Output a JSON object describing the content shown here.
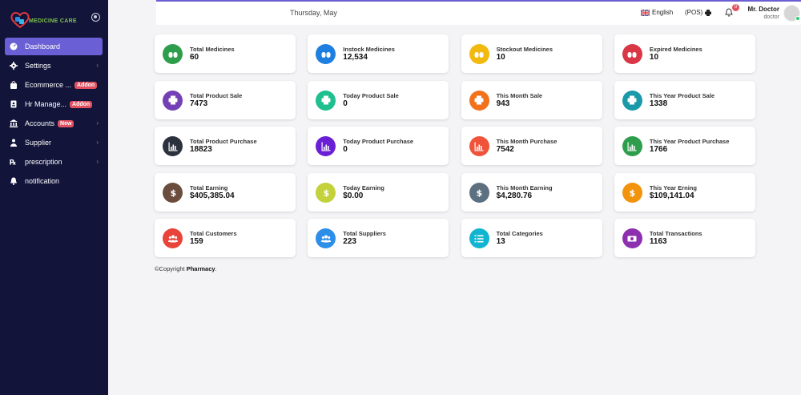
{
  "brand": {
    "name": "MEDICINE CARE"
  },
  "sidebar": {
    "items": [
      {
        "label": "Dashboard",
        "icon": "dashboard-icon",
        "active": true
      },
      {
        "label": "Settings",
        "icon": "gear-icon",
        "chevron": true
      },
      {
        "label": "Ecommerce ...",
        "icon": "shopping-bag-icon",
        "badge": "Addon"
      },
      {
        "label": "Hr Manage...",
        "icon": "id-badge-icon",
        "badge": "Addon"
      },
      {
        "label": "Accounts",
        "icon": "bank-icon",
        "badge": "New",
        "chevron": true
      },
      {
        "label": "Supplier",
        "icon": "truck-icon",
        "chevron": true
      },
      {
        "label": "prescription",
        "icon": "prescription-icon",
        "chevron": true
      },
      {
        "label": "notification",
        "icon": "bell-icon"
      }
    ]
  },
  "topbar": {
    "date": "Thursday, May",
    "language": "English",
    "pos": "(POS)",
    "notification_count": "0",
    "user_name": "Mr. Doctor",
    "user_role": "doctor"
  },
  "cards": [
    {
      "label": "Total Medicines",
      "value": "60",
      "color": "#2e9e4c",
      "icon": "pills-icon"
    },
    {
      "label": "Instock Medicines",
      "value": "12,534",
      "color": "#1e7fe0",
      "icon": "pills-icon"
    },
    {
      "label": "Stockout Medicines",
      "value": "10",
      "color": "#f2b90f",
      "icon": "pills-icon"
    },
    {
      "label": "Expired Medicines",
      "value": "10",
      "color": "#d93646",
      "icon": "pills-icon"
    },
    {
      "label": "Total Product Sale",
      "value": "7473",
      "color": "#7440b5",
      "icon": "printer-icon"
    },
    {
      "label": "Today Product Sale",
      "value": "0",
      "color": "#1fbf8f",
      "icon": "printer-icon"
    },
    {
      "label": "This Month Sale",
      "value": "943",
      "color": "#f2721c",
      "icon": "printer-icon"
    },
    {
      "label": "This Year Product Sale",
      "value": "1338",
      "color": "#1a9aa8",
      "icon": "printer-icon"
    },
    {
      "label": "Total Product Purchase",
      "value": "18823",
      "color": "#2c323d",
      "icon": "bar-chart-icon"
    },
    {
      "label": "Today Product Purchase",
      "value": "0",
      "color": "#6a1fd6",
      "icon": "bar-chart-icon"
    },
    {
      "label": "This Month Purchase",
      "value": "7542",
      "color": "#f0533a",
      "icon": "bar-chart-icon"
    },
    {
      "label": "This Year Product Purchase",
      "value": "1766",
      "color": "#2e9e4c",
      "icon": "bar-chart-icon"
    },
    {
      "label": "Total Earning",
      "value": "$405,385.04",
      "color": "#6b4d3e",
      "icon": "dollar-icon"
    },
    {
      "label": "Today Earning",
      "value": "$0.00",
      "color": "#c3d13b",
      "icon": "dollar-icon"
    },
    {
      "label": "This Month Earning",
      "value": "$4,280.76",
      "color": "#5c7080",
      "icon": "dollar-icon"
    },
    {
      "label": "This Year Erning",
      "value": "$109,141.04",
      "color": "#f2930c",
      "icon": "dollar-icon"
    },
    {
      "label": "Total Customers",
      "value": "159",
      "color": "#e8443a",
      "icon": "users-icon"
    },
    {
      "label": "Total Suppliers",
      "value": "223",
      "color": "#2d8ee8",
      "icon": "users-icon"
    },
    {
      "label": "Total Categories",
      "value": "13",
      "color": "#12b5d1",
      "icon": "list-icon"
    },
    {
      "label": "Total Transactions",
      "value": "1163",
      "color": "#8e2fb0",
      "icon": "money-icon"
    }
  ],
  "footer": {
    "prefix": "©Copyright",
    "brand": "Pharmacy",
    "suffix": "."
  }
}
